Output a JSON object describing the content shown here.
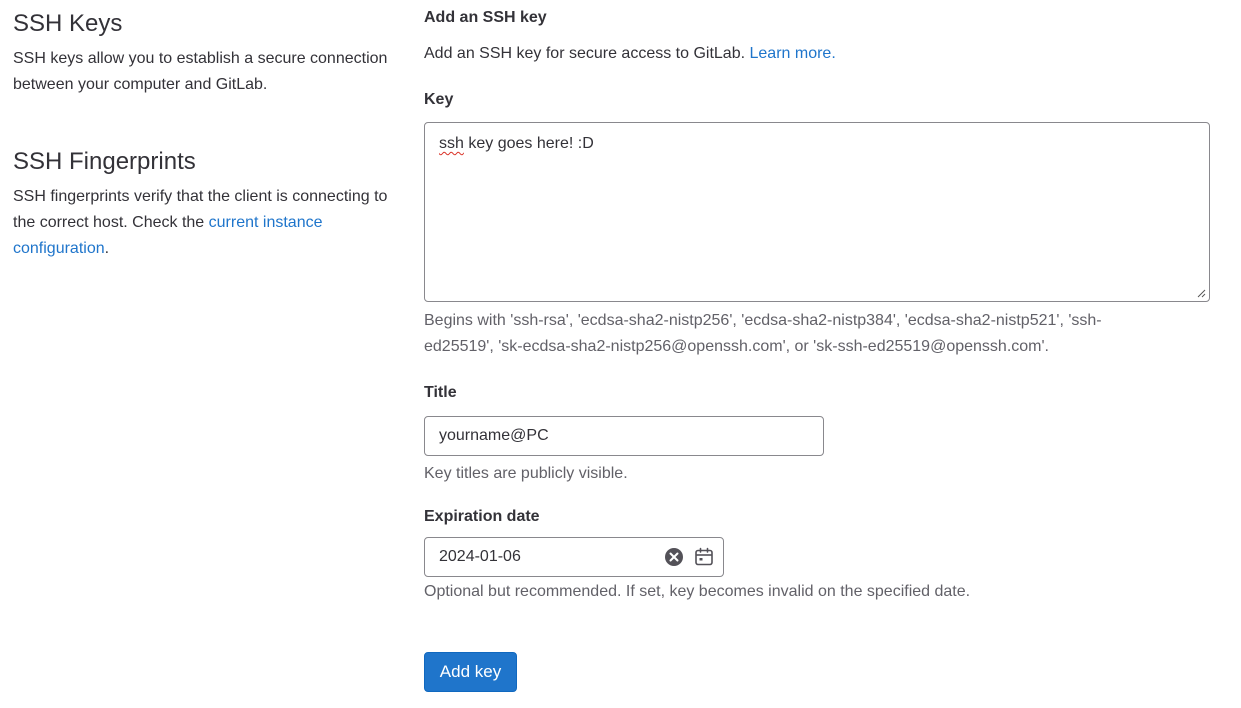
{
  "ssh_keys": {
    "title": "SSH Keys",
    "description": "SSH keys allow you to establish a secure connection between your computer and GitLab."
  },
  "ssh_fingerprints": {
    "title": "SSH Fingerprints",
    "description_prefix": "SSH fingerprints verify that the client is connecting to the correct host. Check the ",
    "link_text": "current instance configuration",
    "description_suffix": "."
  },
  "form": {
    "heading": "Add an SSH key",
    "intro": "Add an SSH key for secure access to GitLab. ",
    "learn_more": "Learn more.",
    "key": {
      "label": "Key",
      "value_misspelled": "ssh",
      "value_rest": " key goes here! :D",
      "help": "Begins with 'ssh-rsa', 'ecdsa-sha2-nistp256', 'ecdsa-sha2-nistp384', 'ecdsa-sha2-nistp521', 'ssh-ed25519', 'sk-ecdsa-sha2-nistp256@openssh.com', or 'sk-ssh-ed25519@openssh.com'."
    },
    "title_field": {
      "label": "Title",
      "value": "yourname@PC",
      "help": "Key titles are publicly visible."
    },
    "expiration": {
      "label": "Expiration date",
      "value": "2024-01-06",
      "help": "Optional but recommended. If set, key becomes invalid on the specified date.",
      "clear_icon": "clear-circle-icon",
      "calendar_icon": "calendar-icon"
    },
    "submit_label": "Add key"
  },
  "colors": {
    "link": "#1f75cb",
    "button": "#1f75cb",
    "text": "#333238",
    "muted": "#626168",
    "border": "#89888d"
  }
}
